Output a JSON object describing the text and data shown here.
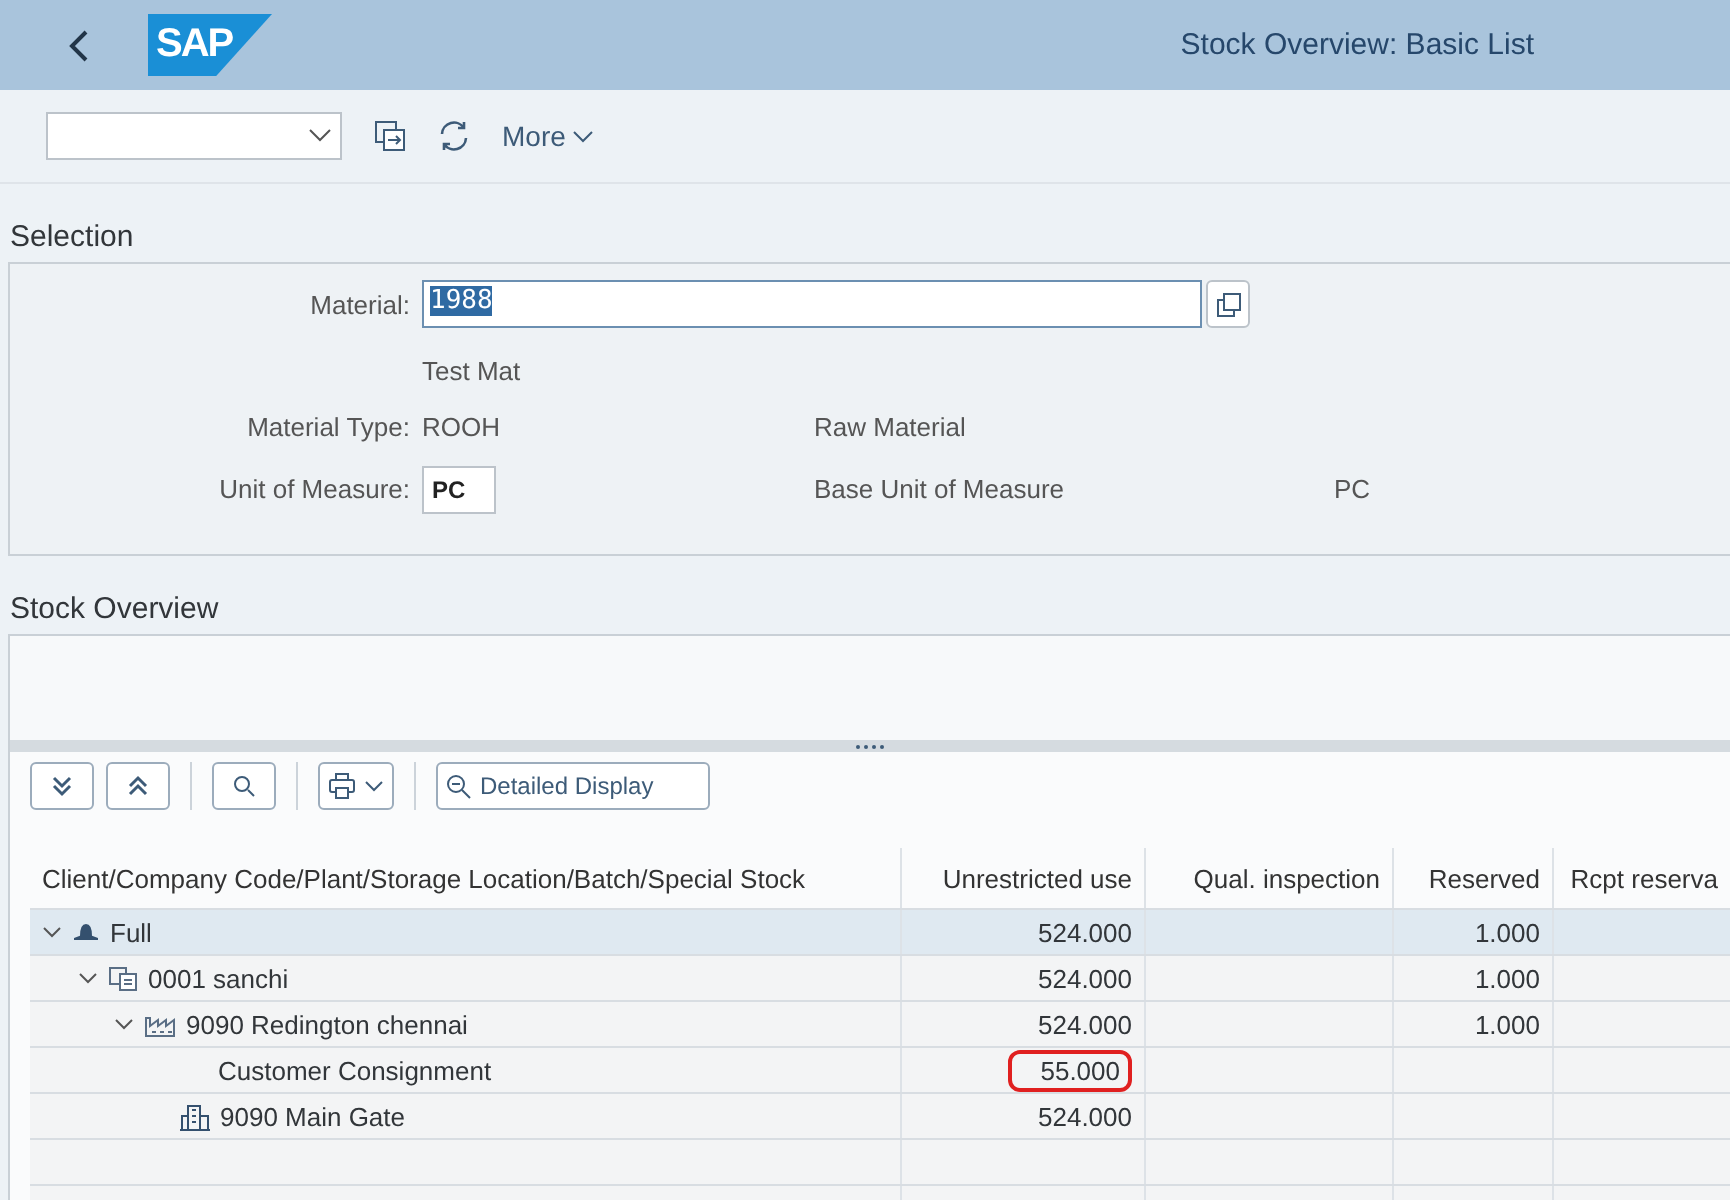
{
  "header": {
    "logo": "SAP",
    "title": "Stock Overview: Basic List"
  },
  "toolbar": {
    "more": "More"
  },
  "selection": {
    "title": "Selection",
    "material": {
      "label": "Material:",
      "value": "1988",
      "description": "Test Mat"
    },
    "material_type": {
      "label": "Material Type:",
      "value": "ROOH",
      "description": "Raw Material"
    },
    "unit": {
      "label": "Unit of Measure:",
      "value": "PC",
      "base_label": "Base Unit of Measure",
      "base_value": "PC"
    }
  },
  "stock_overview": {
    "title": "Stock Overview",
    "buttons": {
      "detailed_display": "Detailed Display"
    },
    "table": {
      "columns": [
        "Client/Company Code/Plant/Storage Location/Batch/Special Stock",
        "Unrestricted use",
        "Qual. inspection",
        "Reserved",
        "Rcpt reserva"
      ],
      "rows": [
        {
          "kind": "client",
          "label": "Full",
          "unrestricted": "524.000",
          "reserved": "1.000",
          "expanded": true,
          "selected": true,
          "children": [
            {
              "kind": "company",
              "label": "0001 sanchi",
              "unrestricted": "524.000",
              "reserved": "1.000",
              "expanded": true,
              "selected": false,
              "children": [
                {
                  "kind": "plant",
                  "label": "9090 Redington chennai",
                  "unrestricted": "524.000",
                  "reserved": "1.000",
                  "expanded": true,
                  "selected": false,
                  "children": [
                    {
                      "kind": "special",
                      "label": "Customer Consignment",
                      "unrestricted": "55.000",
                      "highlighted": true,
                      "selected": false
                    },
                    {
                      "kind": "storage",
                      "label": "9090 Main Gate",
                      "unrestricted": "524.000",
                      "selected": false
                    }
                  ]
                }
              ]
            }
          ]
        }
      ]
    }
  }
}
